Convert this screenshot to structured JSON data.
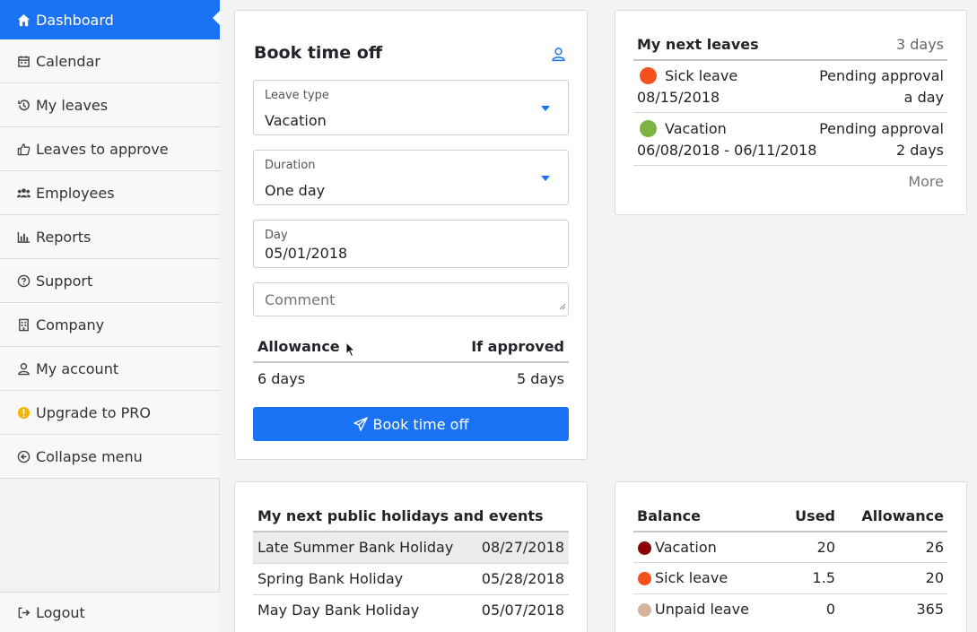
{
  "sidebar": {
    "items": [
      {
        "label": "Dashboard",
        "icon": "home-icon"
      },
      {
        "label": "Calendar",
        "icon": "calendar-icon"
      },
      {
        "label": "My leaves",
        "icon": "history-icon"
      },
      {
        "label": "Leaves to approve",
        "icon": "thumbs-up-icon"
      },
      {
        "label": "Employees",
        "icon": "users-icon"
      },
      {
        "label": "Reports",
        "icon": "bar-chart-icon"
      },
      {
        "label": "Support",
        "icon": "question-circle-icon"
      },
      {
        "label": "Company",
        "icon": "building-icon"
      },
      {
        "label": "My account",
        "icon": "user-icon"
      },
      {
        "label": "Upgrade to PRO",
        "icon": "warning-badge-icon"
      },
      {
        "label": "Collapse menu",
        "icon": "arrow-circle-left-icon"
      }
    ],
    "logout": "Logout"
  },
  "book": {
    "title": "Book time off",
    "leave_type_label": "Leave type",
    "leave_type_value": "Vacation",
    "duration_label": "Duration",
    "duration_value": "One day",
    "day_label": "Day",
    "day_value": "05/01/2018",
    "comment_placeholder": "Comment",
    "allowance_header": "Allowance",
    "if_approved_header": "If approved",
    "allowance_value": "6 days",
    "if_approved_value": "5 days",
    "submit_label": "Book time off"
  },
  "next_leaves": {
    "title": "My next leaves",
    "count": "3 days",
    "items": [
      {
        "type": "Sick leave",
        "color": "#f4511e",
        "status": "Pending approval",
        "dates": "08/15/2018",
        "duration": "a day"
      },
      {
        "type": "Vacation",
        "color": "#7cb342",
        "status": "Pending approval",
        "dates": "06/08/2018 - 06/11/2018",
        "duration": "2 days"
      }
    ],
    "more": "More"
  },
  "holidays": {
    "title": "My next public holidays and events",
    "items": [
      {
        "name": "Late Summer Bank Holiday",
        "date": "08/27/2018"
      },
      {
        "name": "Spring Bank Holiday",
        "date": "05/28/2018"
      },
      {
        "name": "May Day Bank Holiday",
        "date": "05/07/2018"
      }
    ]
  },
  "balance": {
    "title": "Balance",
    "used_header": "Used",
    "allowance_header": "Allowance",
    "rows": [
      {
        "type": "Vacation",
        "color": "#8b0000",
        "used": "20",
        "allowance": "26"
      },
      {
        "type": "Sick leave",
        "color": "#f4511e",
        "used": "1.5",
        "allowance": "20"
      },
      {
        "type": "Unpaid leave",
        "color": "#d7b49e",
        "used": "0",
        "allowance": "365"
      }
    ]
  },
  "colors": {
    "accent": "#1a73f4"
  }
}
